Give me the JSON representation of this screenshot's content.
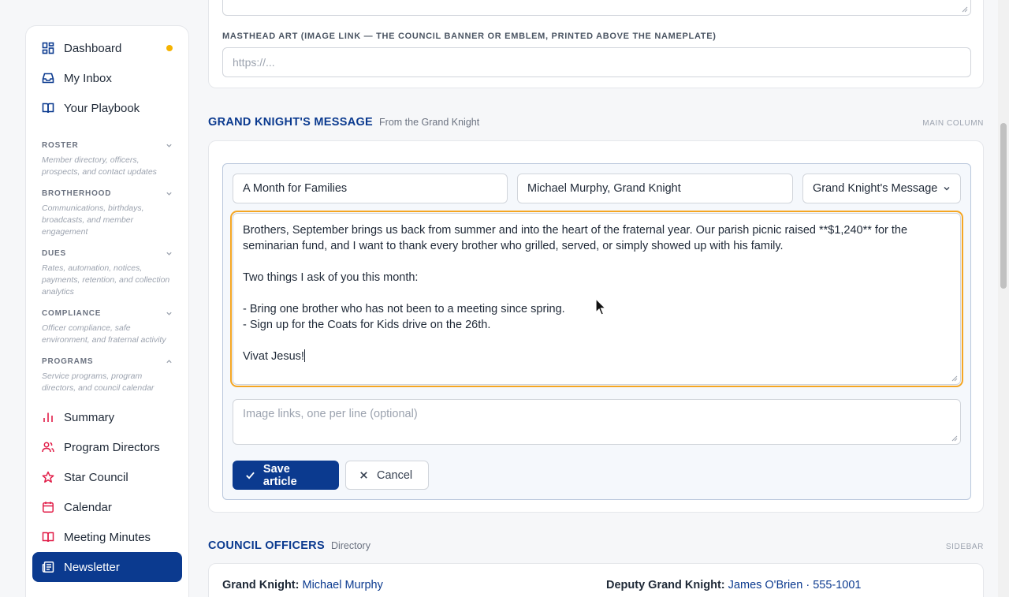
{
  "sidebar": {
    "top_items": [
      {
        "label": "Dashboard",
        "icon": "dashboard-icon",
        "has_dot": true
      },
      {
        "label": "My Inbox",
        "icon": "inbox-icon"
      },
      {
        "label": "Your Playbook",
        "icon": "book-icon"
      }
    ],
    "groups": [
      {
        "title": "ROSTER",
        "desc": "Member directory, officers, prospects, and contact updates",
        "expanded": false
      },
      {
        "title": "BROTHERHOOD",
        "desc": "Communications, birthdays, broadcasts, and member engagement",
        "expanded": false
      },
      {
        "title": "DUES",
        "desc": "Rates, automation, notices, payments, retention, and collection analytics",
        "expanded": false
      },
      {
        "title": "COMPLIANCE",
        "desc": "Officer compliance, safe environment, and fraternal activity",
        "expanded": false
      },
      {
        "title": "PROGRAMS",
        "desc": "Service programs, program directors, and council calendar",
        "expanded": true
      }
    ],
    "program_items": [
      {
        "label": "Summary",
        "icon": "bar-chart-icon"
      },
      {
        "label": "Program Directors",
        "icon": "users-icon"
      },
      {
        "label": "Star Council",
        "icon": "star-icon"
      },
      {
        "label": "Calendar",
        "icon": "calendar-icon"
      },
      {
        "label": "Meeting Minutes",
        "icon": "open-book-icon"
      },
      {
        "label": "Newsletter",
        "icon": "newspaper-icon",
        "active": true
      }
    ]
  },
  "masthead": {
    "label": "MASTHEAD ART (IMAGE LINK — THE COUNCIL BANNER OR EMBLEM, PRINTED ABOVE THE NAMEPLATE)",
    "placeholder": "https://..."
  },
  "gk_section": {
    "title": "GRAND KNIGHT'S MESSAGE",
    "subtitle": "From the Grand Knight",
    "tag": "MAIN COLUMN",
    "headline": "A Month for Families",
    "byline": "Michael Murphy, Grand Knight",
    "category": "Grand Knight's Message",
    "body": "Brothers, September brings us back from summer and into the heart of the fraternal year. Our parish picnic raised **$1,240** for the seminarian fund, and I want to thank every brother who grilled, served, or simply showed up with his family.\n\nTwo things I ask of you this month:\n\n- Bring one brother who has not been to a meeting since spring.\n- Sign up for the Coats for Kids drive on the 26th.\n\nVivat Jesus!",
    "links_placeholder": "Image links, one per line (optional)",
    "save_label": "Save article",
    "cancel_label": "Cancel"
  },
  "officers_section": {
    "title": "COUNCIL OFFICERS",
    "subtitle": "Directory",
    "tag": "SIDEBAR",
    "officers": [
      {
        "role": "Grand Knight:",
        "value": "Michael Murphy"
      },
      {
        "role": "Deputy Grand Knight:",
        "value": "James O'Brien · 555-1001"
      }
    ]
  },
  "colors": {
    "brand": "#0b3a8f",
    "focus_outline": "#f5a623",
    "notification_dot": "#f5b301"
  }
}
